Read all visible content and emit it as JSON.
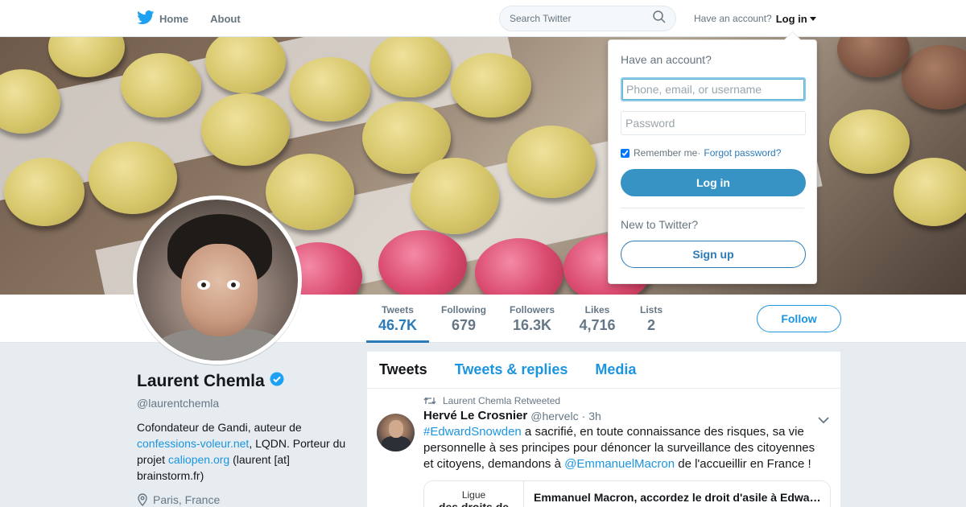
{
  "nav": {
    "home_label": "Home",
    "about_label": "About",
    "search_placeholder": "Search Twitter",
    "have_account": "Have an account?",
    "login_label": "Log in"
  },
  "colors": {
    "accent": "#1b95e0",
    "link": "#2b7bb9",
    "login_button": "#3693c4",
    "background": "#e6ecf0"
  },
  "icons": [
    "twitter-bird-icon",
    "search-icon",
    "caret-down-icon",
    "verified-badge-icon",
    "location-pin-icon",
    "retweet-icon",
    "chevron-down-icon"
  ],
  "stats": [
    {
      "label": "Tweets",
      "value": "46.7K",
      "active": true
    },
    {
      "label": "Following",
      "value": "679"
    },
    {
      "label": "Followers",
      "value": "16.3K"
    },
    {
      "label": "Likes",
      "value": "4,716"
    },
    {
      "label": "Lists",
      "value": "2"
    }
  ],
  "follow_label": "Follow",
  "profile": {
    "name": "Laurent Chemla",
    "handle": "@laurentchemla",
    "bio_1": "Cofondateur de Gandi, auteur de",
    "bio_link_1": "confessions-voleur.net",
    "bio_2": ", LQDN. Porteur du projet",
    "bio_link_2": "caliopen.org",
    "bio_3": " (laurent [at] brainstorm.fr)",
    "location": "Paris, France"
  },
  "timeline": {
    "tabs": [
      "Tweets",
      "Tweets & replies",
      "Media"
    ],
    "tweet": {
      "retweeted_by": "Laurent Chemla Retweeted",
      "author": "Hervé Le Crosnier",
      "handle": "@hervelc",
      "time": "3h",
      "hashtag": "#EdwardSnowden",
      "text_1": " a sacrifié, en toute connaissance des risques, sa vie personnelle à ses principes pour dénoncer la surveillance des citoyennes et citoyens, demandons à ",
      "mention": "@EmmanuelMacron",
      "text_2": " de l'accueillir en France !",
      "card_image_line1": "Ligue",
      "card_image_line2": "des droits de",
      "card_title": "Emmanuel Macron, accordez le droit d'asile à Edward Snowden"
    }
  },
  "login_dropdown": {
    "title": "Have an account?",
    "username_placeholder": "Phone, email, or username",
    "password_placeholder": "Password",
    "remember_label": "Remember me",
    "separator": " · ",
    "forgot_label": "Forgot password?",
    "login_button": "Log in",
    "new_label": "New to Twitter?",
    "signup_button": "Sign up"
  }
}
